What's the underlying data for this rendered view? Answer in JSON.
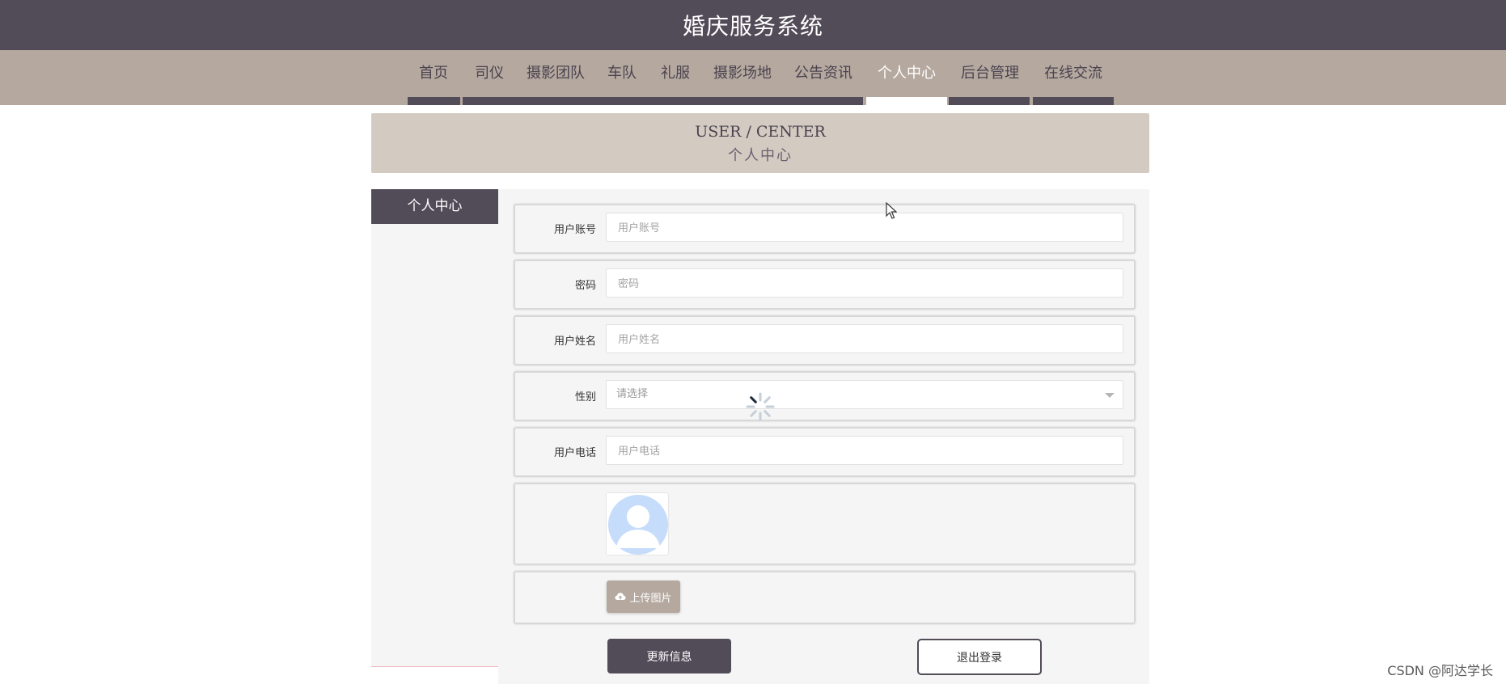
{
  "header": {
    "title": "婚庆服务系统"
  },
  "nav": {
    "items": [
      {
        "label": "首页"
      },
      {
        "label": "司仪"
      },
      {
        "label": "摄影团队"
      },
      {
        "label": "车队"
      },
      {
        "label": "礼服"
      },
      {
        "label": "摄影场地"
      },
      {
        "label": "公告资讯"
      },
      {
        "label": "个人中心",
        "active": true
      },
      {
        "label": "后台管理"
      },
      {
        "label": "在线交流"
      }
    ]
  },
  "banner": {
    "en": "USER / CENTER",
    "cn": "个人中心"
  },
  "sidebar": {
    "title": "个人中心"
  },
  "form": {
    "account": {
      "label": "用户账号",
      "placeholder": "用户账号",
      "value": ""
    },
    "password": {
      "label": "密码",
      "placeholder": "密码",
      "value": ""
    },
    "name": {
      "label": "用户姓名",
      "placeholder": "用户姓名",
      "value": ""
    },
    "gender": {
      "label": "性别",
      "selected": "请选择"
    },
    "phone": {
      "label": "用户电话",
      "placeholder": "用户电话",
      "value": ""
    },
    "upload_label": "上传图片",
    "update_label": "更新信息",
    "logout_label": "退出登录"
  },
  "watermark": "CSDN @阿达学长",
  "colors": {
    "primary": "#524b58",
    "nav_bg": "#b5a89f",
    "banner_bg": "#d3cbc1",
    "panel_bg": "#f5f5f5"
  }
}
